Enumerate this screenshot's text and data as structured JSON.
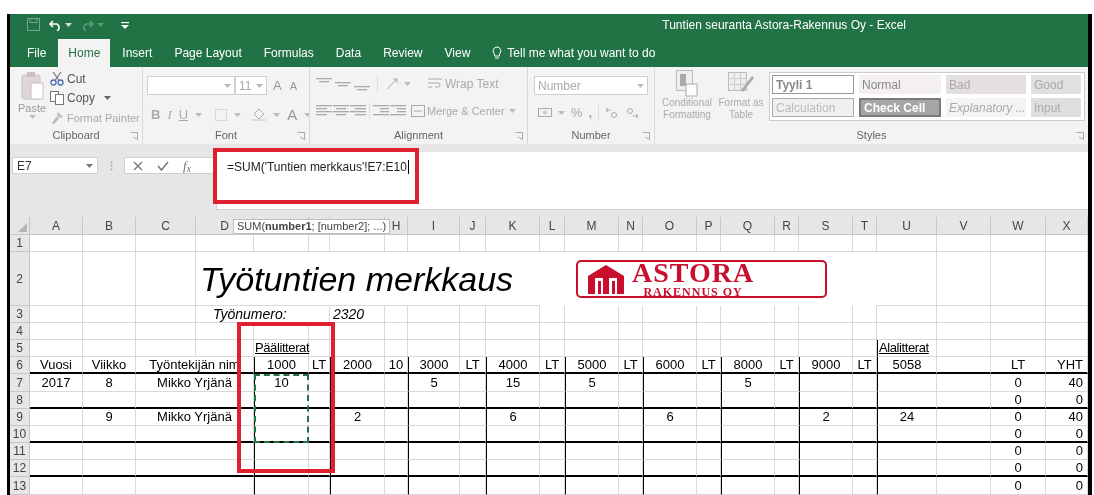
{
  "window": {
    "title": "Tuntien seuranta Astora-Rakennus Oy - Excel"
  },
  "tabs": [
    {
      "label": "File",
      "selected": false
    },
    {
      "label": "Home",
      "selected": true
    },
    {
      "label": "Insert",
      "selected": false
    },
    {
      "label": "Page Layout",
      "selected": false
    },
    {
      "label": "Formulas",
      "selected": false
    },
    {
      "label": "Data",
      "selected": false
    },
    {
      "label": "Review",
      "selected": false
    },
    {
      "label": "View",
      "selected": false
    }
  ],
  "tell_me": {
    "placeholder": "Tell me what you want to do"
  },
  "ribbon": {
    "clipboard": {
      "paste": "Paste",
      "cut": "Cut",
      "copy": "Copy",
      "format_painter": "Format Painter",
      "label": "Clipboard"
    },
    "font": {
      "size": "11",
      "grow": "A",
      "shrink": "A",
      "bold": "B",
      "italic": "I",
      "underline": "U",
      "text_color_button": "A",
      "label": "Font"
    },
    "alignment": {
      "wrap_text": "Wrap Text",
      "merge_center": "Merge & Center",
      "label": "Alignment"
    },
    "number": {
      "format": "Number",
      "percent": "%",
      "comma": ",",
      "label": "Number"
    },
    "conditional_formatting": "Conditional Formatting",
    "format_as_table": "Format as Table",
    "styles": {
      "cells": [
        {
          "label": "Tyyli 1",
          "kind": "custom"
        },
        {
          "label": "Normal",
          "kind": "normal"
        },
        {
          "label": "Bad",
          "kind": "bad"
        },
        {
          "label": "Good",
          "kind": "good"
        },
        {
          "label": "Calculation",
          "kind": "calculation"
        },
        {
          "label": "Check Cell",
          "kind": "check"
        },
        {
          "label": "Explanatory ...",
          "kind": "explanatory"
        },
        {
          "label": "Input",
          "kind": "input"
        }
      ],
      "label": "Styles"
    }
  },
  "formula_bar": {
    "name_box": "E7",
    "function_label": "f$_{x}$",
    "formula": "=SUM('Tuntien merkkaus'!E7:E10"
  },
  "tooltip": "SUM(**number1**; [number2]; ...)",
  "sheet": {
    "column_headers": [
      "A",
      "B",
      "C",
      "D",
      "H",
      "I",
      "J",
      "K",
      "L",
      "M",
      "N",
      "O",
      "P",
      "Q",
      "R",
      "S",
      "T",
      "U",
      "V",
      "W",
      "X"
    ],
    "logo": {
      "name": "ASTORA",
      "subtitle": "RAKENNUS OY"
    },
    "rows": [
      {
        "header": "1",
        "kind": "plain"
      },
      {
        "header": "2",
        "kind": "title",
        "cells": [
          "",
          "",
          "",
          "Työtuntien merkkaus"
        ]
      },
      {
        "header": "3",
        "kind": "italic",
        "cells": [
          "",
          "",
          "",
          "Työnumero:",
          "2320"
        ]
      },
      {
        "header": "4",
        "kind": "plain"
      },
      {
        "header": "5",
        "kind": "underline",
        "cells": [
          "",
          "",
          "",
          "",
          "Päälitterat",
          "",
          "",
          "",
          "",
          "",
          "",
          "",
          "",
          "",
          "",
          "",
          "",
          "",
          "",
          "",
          "Alalitterat"
        ]
      },
      {
        "header": "6",
        "kind": "plain",
        "cells": [
          "Vuosi",
          "Viikko",
          "Työntekijän nim",
          "1000",
          "LT",
          "2000",
          "10",
          "3000",
          "LT",
          "4000",
          "LT",
          "5000",
          "LT",
          "6000",
          "LT",
          "8000",
          "LT",
          "9000",
          "LT",
          "5058",
          "",
          "LT",
          "YHT"
        ]
      },
      {
        "header": "7",
        "kind": "plain",
        "cells": [
          "2017",
          "8",
          "Mikko Yrjänä",
          "10",
          "",
          "",
          "",
          "5",
          "",
          "15",
          "",
          "5",
          "",
          "",
          "",
          "5",
          "",
          "",
          "",
          "",
          "",
          "0",
          "40"
        ]
      },
      {
        "header": "8",
        "kind": "plain",
        "cells": [
          "",
          "",
          "",
          "",
          "",
          "",
          "",
          "",
          "",
          "",
          "",
          "",
          "",
          "",
          "",
          "",
          "",
          "",
          "",
          "",
          "",
          "0",
          "0"
        ]
      },
      {
        "header": "9",
        "kind": "plain",
        "cells": [
          "",
          "9",
          "Mikko Yrjänä",
          "",
          "",
          "2",
          "",
          "",
          "",
          "6",
          "",
          "",
          "",
          "6",
          "",
          "",
          "",
          "2",
          "",
          "24",
          "",
          "0",
          "40"
        ]
      },
      {
        "header": "10",
        "kind": "plain",
        "cells": [
          "",
          "",
          "",
          "",
          "",
          "",
          "",
          "",
          "",
          "",
          "",
          "",
          "",
          "",
          "",
          "",
          "",
          "",
          "",
          "",
          "",
          "0",
          "0"
        ]
      },
      {
        "header": "11",
        "kind": "plain",
        "cells": [
          "",
          "",
          "",
          "",
          "",
          "",
          "",
          "",
          "",
          "",
          "",
          "",
          "",
          "",
          "",
          "",
          "",
          "",
          "",
          "",
          "",
          "0",
          "0"
        ]
      },
      {
        "header": "12",
        "kind": "plain",
        "cells": [
          "",
          "",
          "",
          "",
          "",
          "",
          "",
          "",
          "",
          "",
          "",
          "",
          "",
          "",
          "",
          "",
          "",
          "",
          "",
          "",
          "",
          "0",
          "0"
        ]
      },
      {
        "header": "13",
        "kind": "plain",
        "cells": [
          "",
          "",
          "",
          "",
          "",
          "",
          "",
          "",
          "",
          "",
          "",
          "",
          "",
          "",
          "",
          "",
          "",
          "",
          "",
          "",
          "",
          "0",
          "0"
        ]
      }
    ]
  }
}
